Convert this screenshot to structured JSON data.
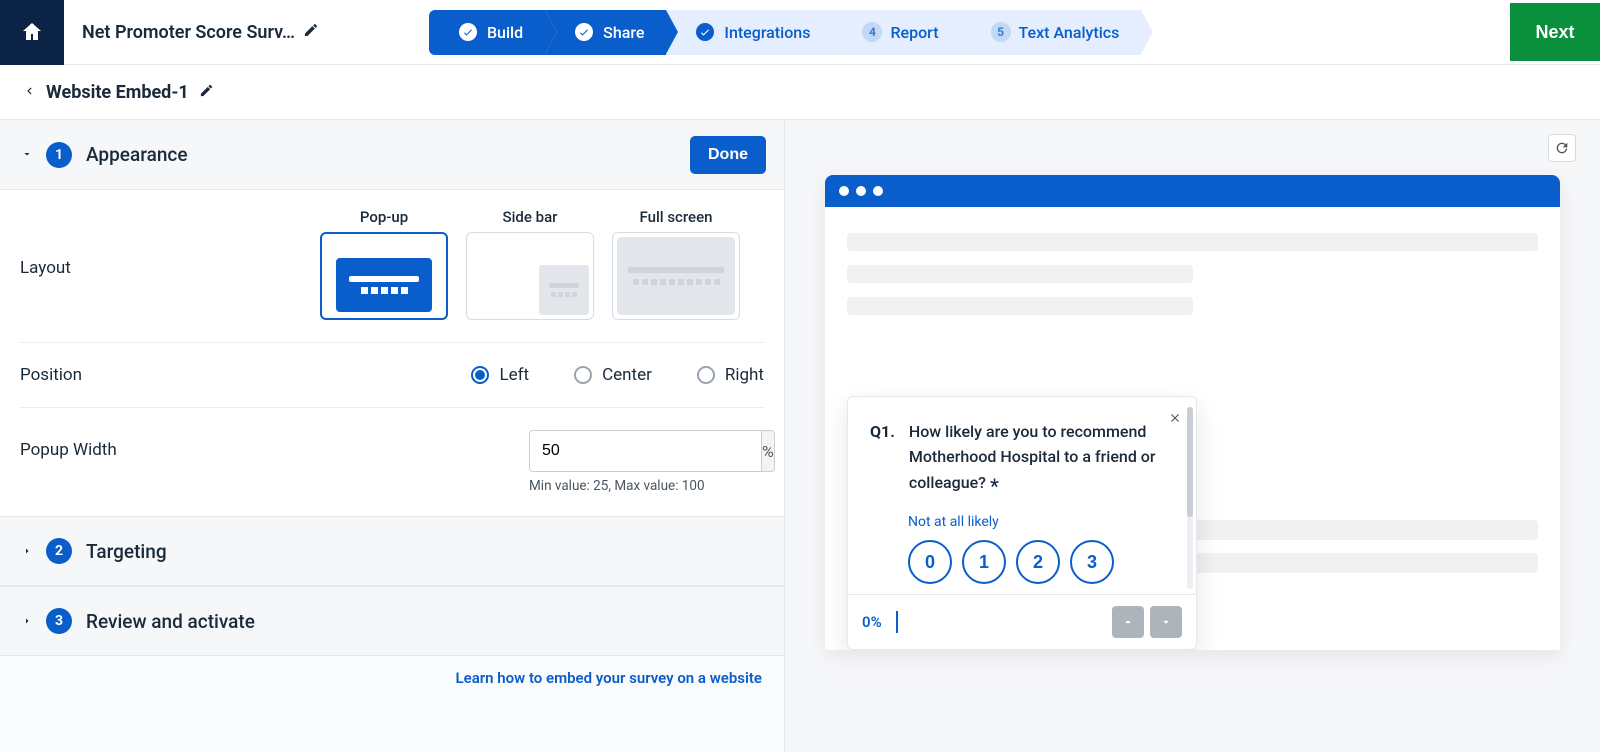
{
  "header": {
    "survey_name": "Net Promoter Score Surv…",
    "next_label": "Next",
    "steps": [
      {
        "label": "Build",
        "done": true,
        "style": "blue"
      },
      {
        "label": "Share",
        "done": true,
        "style": "blue"
      },
      {
        "label": "Integrations",
        "done": true,
        "style": "light"
      },
      {
        "label": "Report",
        "num": "4",
        "style": "light"
      },
      {
        "label": "Text Analytics",
        "num": "5",
        "style": "light"
      }
    ]
  },
  "crumb": {
    "title": "Website Embed-1"
  },
  "sections": {
    "appearance": {
      "num": "1",
      "label": "Appearance",
      "done_label": "Done",
      "layout": {
        "label": "Layout",
        "options": [
          "Pop-up",
          "Side bar",
          "Full screen"
        ],
        "selected": 0
      },
      "position": {
        "label": "Position",
        "options": [
          "Left",
          "Center",
          "Right"
        ],
        "selected": 0
      },
      "width": {
        "label": "Popup Width",
        "value": "50",
        "unit": "%",
        "hint": "Min value: 25, Max value: 100"
      }
    },
    "targeting": {
      "num": "2",
      "label": "Targeting"
    },
    "review": {
      "num": "3",
      "label": "Review and activate"
    },
    "learn_link": "Learn how to embed your survey on a website"
  },
  "preview": {
    "question_num": "Q1.",
    "question_text": "How likely are you to recommend Motherhood Hospital to a friend or colleague? ",
    "required_mark": "*",
    "scale_low_label": "Not at all likely",
    "scale_values": [
      "0",
      "1",
      "2",
      "3"
    ],
    "progress": "0%"
  }
}
